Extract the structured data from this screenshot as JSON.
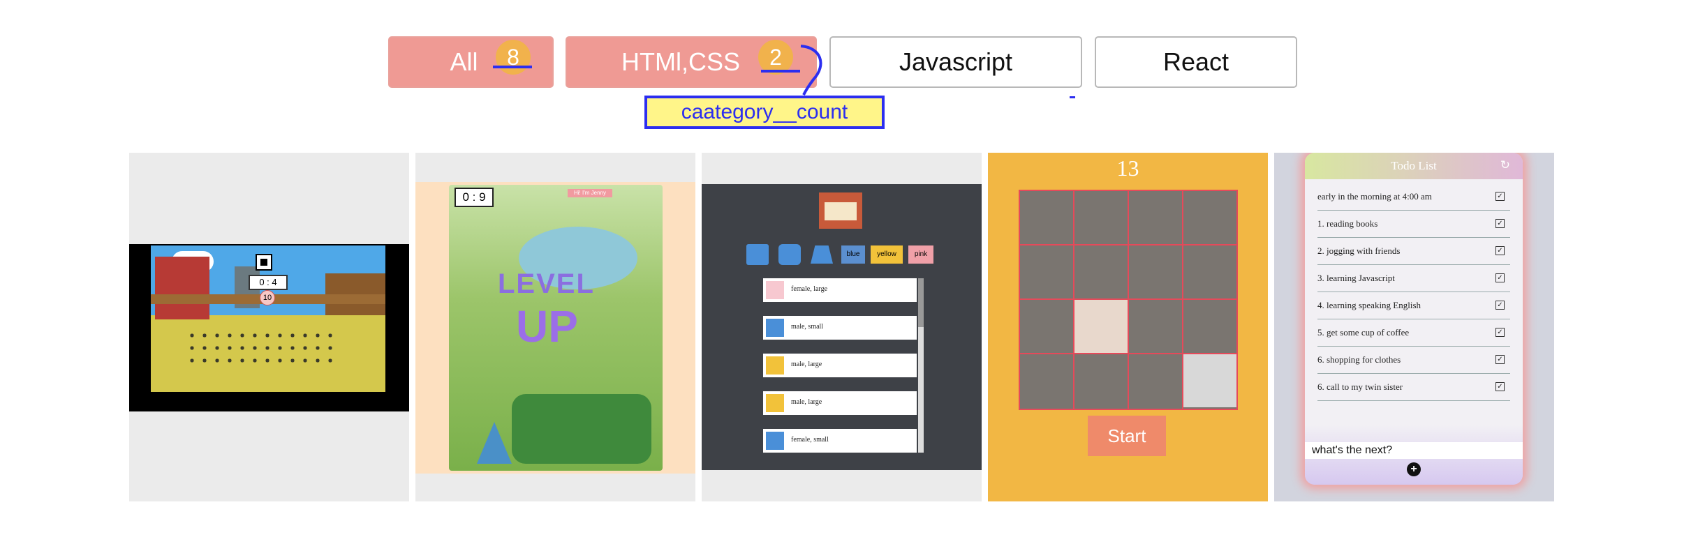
{
  "tabs": {
    "all": {
      "label": "All",
      "count": "8"
    },
    "htmlcss": {
      "label": "HTMl,CSS",
      "count": "2"
    },
    "javascript": {
      "label": "Javascript"
    },
    "react": {
      "label": "React"
    }
  },
  "annotation": {
    "label": "caategory__count"
  },
  "cards": {
    "farm": {
      "counter": "0 : 4",
      "lives": "10"
    },
    "wheres": {
      "timer": "0 : 9",
      "speech": "Hi! I'm Jenny",
      "level": "LEVEL",
      "up": "UP"
    },
    "shop": {
      "colors": [
        "blue",
        "yellow",
        "pink"
      ],
      "items": [
        "female, large",
        "male, small",
        "male, large",
        "male, large",
        "female, small"
      ]
    },
    "puzzle": {
      "number": "13",
      "start": "Start"
    },
    "todo": {
      "title": "Todo List",
      "items": [
        "early in the morning at 4:00 am",
        "1. reading books",
        "2. jogging with friends",
        "3. learning Javascript",
        "4. learning speaking English",
        "5. get some cup of coffee",
        "6. shopping for clothes",
        "6. call to my twin sister"
      ],
      "input_value": "what's the next?"
    }
  },
  "colors": {
    "tab_active": "#ef9a94",
    "badge": "#f1b24c",
    "annotation_blue": "#2c2ef0",
    "annotation_fill": "#fff589",
    "puzzle_bg": "#f2b744",
    "shop_bg": "#3e4147"
  }
}
